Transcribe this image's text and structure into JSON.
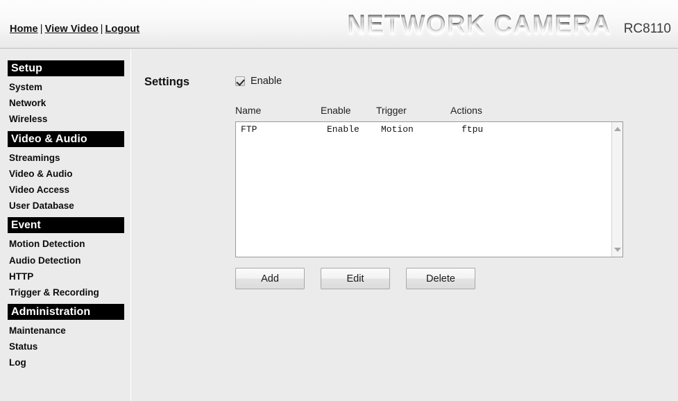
{
  "header": {
    "nav": [
      {
        "label": "Home"
      },
      {
        "label": "View Video"
      },
      {
        "label": "Logout"
      }
    ],
    "separator": "|",
    "logo_title": "NETWORK CAMERA",
    "model": "RC8110"
  },
  "sidebar": {
    "sections": [
      {
        "title": "Setup",
        "items": [
          {
            "label": "System"
          },
          {
            "label": "Network"
          },
          {
            "label": "Wireless"
          }
        ]
      },
      {
        "title": "Video & Audio",
        "items": [
          {
            "label": "Streamings"
          },
          {
            "label": "Video & Audio"
          },
          {
            "label": "Video Access"
          },
          {
            "label": "User Database"
          }
        ]
      },
      {
        "title": "Event",
        "items": [
          {
            "label": "Motion Detection"
          },
          {
            "label": "Audio Detection"
          },
          {
            "label": "HTTP"
          },
          {
            "label": "Trigger & Recording"
          }
        ]
      },
      {
        "title": "Administration",
        "items": [
          {
            "label": "Maintenance"
          },
          {
            "label": "Status"
          },
          {
            "label": "Log"
          }
        ]
      }
    ]
  },
  "main": {
    "settings_label": "Settings",
    "enable_checkbox": {
      "label": "Enable",
      "checked": true
    },
    "table": {
      "columns": [
        "Name",
        "Enable",
        "Trigger",
        "Actions"
      ],
      "rows": [
        {
          "name": "FTP",
          "enable": "Enable",
          "trigger": "Motion",
          "actions": "ftpu"
        }
      ]
    },
    "scrollbar": {
      "up_icon": "triangle-up-icon",
      "down_icon": "triangle-down-icon"
    },
    "buttons": [
      {
        "label": "Add"
      },
      {
        "label": "Edit"
      },
      {
        "label": "Delete"
      }
    ]
  },
  "colors": {
    "page_bg": "#ebebeb",
    "section_bar_bg": "#000000",
    "section_bar_text": "#ffffff",
    "listbox_bg": "#ffffff",
    "border": "#9a9a9a"
  }
}
